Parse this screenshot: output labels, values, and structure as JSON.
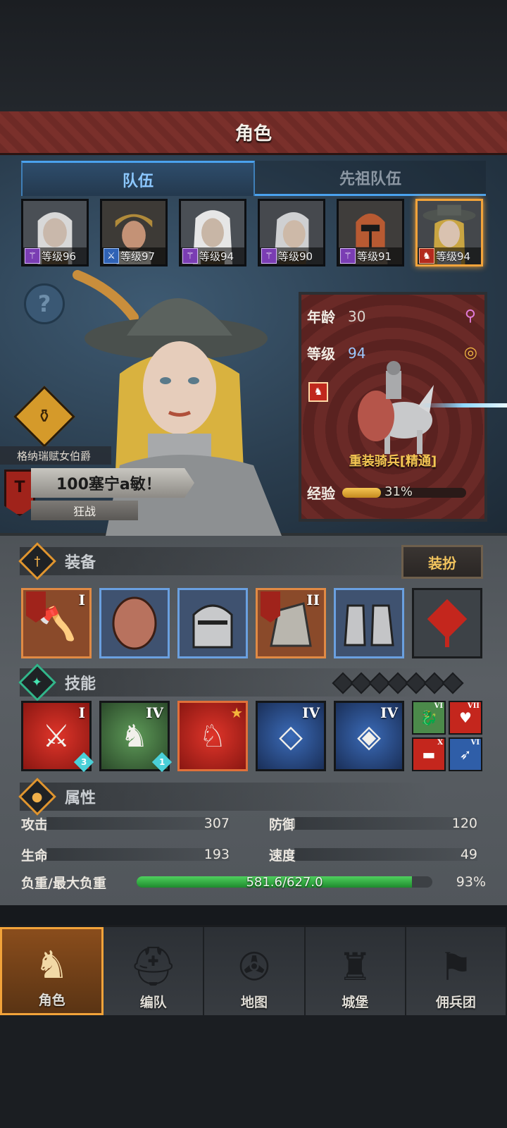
{
  "header": {
    "title": "角色"
  },
  "tabs": [
    {
      "label": "队伍",
      "active": true
    },
    {
      "label": "先祖队伍",
      "active": false
    }
  ],
  "roster": [
    {
      "level_text": "等级96",
      "class_icon": "staff-icon",
      "class_color": "purple",
      "selected": false
    },
    {
      "level_text": "等级97",
      "class_icon": "sword-icon",
      "class_color": "blue",
      "selected": false
    },
    {
      "level_text": "等级94",
      "class_icon": "staff-icon",
      "class_color": "purple",
      "selected": false
    },
    {
      "level_text": "等级90",
      "class_icon": "staff-icon",
      "class_color": "purple",
      "selected": false
    },
    {
      "level_text": "等级91",
      "class_icon": "staff-icon",
      "class_color": "purple",
      "selected": false
    },
    {
      "level_text": "等级94",
      "class_icon": "horse-icon",
      "class_color": "red",
      "selected": true
    }
  ],
  "hero": {
    "title": "格纳瑞赋女伯爵",
    "name": "100塞宁a敏！",
    "class": "狂战"
  },
  "info": {
    "age_label": "年龄",
    "age": "30",
    "level_label": "等级",
    "level": "94",
    "unit_type": "重装骑兵[精通]",
    "exp_label": "经验",
    "exp_percent": "31%",
    "exp_fraction": 0.31
  },
  "equipment": {
    "section_title": "装备",
    "dress_button": "装扮",
    "slots": [
      {
        "name": "weapon-slot",
        "icon": "axe-icon",
        "roman": "I",
        "quality": "orange"
      },
      {
        "name": "shield-slot",
        "icon": "shield-icon",
        "roman": "",
        "quality": "blue"
      },
      {
        "name": "helmet-slot",
        "icon": "helmet-icon",
        "roman": "",
        "quality": "blue"
      },
      {
        "name": "armor-slot",
        "icon": "armor-icon",
        "roman": "II",
        "quality": "orange"
      },
      {
        "name": "boots-slot",
        "icon": "boots-icon",
        "roman": "",
        "quality": "blue"
      },
      {
        "name": "accessory-slot",
        "icon": "knot-icon",
        "roman": "",
        "quality": "gray"
      }
    ]
  },
  "skills": {
    "section_title": "技能",
    "items": [
      {
        "icon": "slash-icon",
        "roman": "I",
        "color": "red",
        "gem": "3"
      },
      {
        "icon": "horse-slash-icon",
        "roman": "IV",
        "color": "green",
        "gem": "1"
      },
      {
        "icon": "horse-up-icon",
        "roman": "",
        "color": "orange-border",
        "star": true
      },
      {
        "icon": "crystal-sword-icon",
        "roman": "IV",
        "color": "blue"
      },
      {
        "icon": "crystal-horse-icon",
        "roman": "IV",
        "color": "blue"
      }
    ],
    "mini": [
      {
        "icon": "dragon-icon",
        "roman": "VI",
        "color": "green"
      },
      {
        "icon": "heart-icon",
        "roman": "VII",
        "color": "red"
      },
      {
        "icon": "dumbbell-icon",
        "roman": "X",
        "color": "red"
      },
      {
        "icon": "eagle-icon",
        "roman": "VI",
        "color": "blue"
      }
    ]
  },
  "attributes": {
    "section_title": "属性",
    "attack_label": "攻击",
    "attack": "307",
    "defense_label": "防御",
    "defense": "120",
    "hp_label": "生命",
    "hp": "193",
    "speed_label": "速度",
    "speed": "49",
    "load_label": "负重/最大负重",
    "load_text": "581.6/627.0",
    "load_percent": "93%",
    "load_fraction": 0.93
  },
  "nav": [
    {
      "label": "角色",
      "icon": "knight-icon",
      "active": true
    },
    {
      "label": "编队",
      "icon": "helmet-group-icon",
      "active": false
    },
    {
      "label": "地图",
      "icon": "compass-icon",
      "active": false
    },
    {
      "label": "城堡",
      "icon": "castle-icon",
      "active": false
    },
    {
      "label": "佣兵团",
      "icon": "flag-icon",
      "active": false
    }
  ],
  "colors": {
    "accent": "#f2a33a",
    "tab_active": "#4aa2ee",
    "exp": "#f5c653",
    "load": "#4fd15e"
  }
}
